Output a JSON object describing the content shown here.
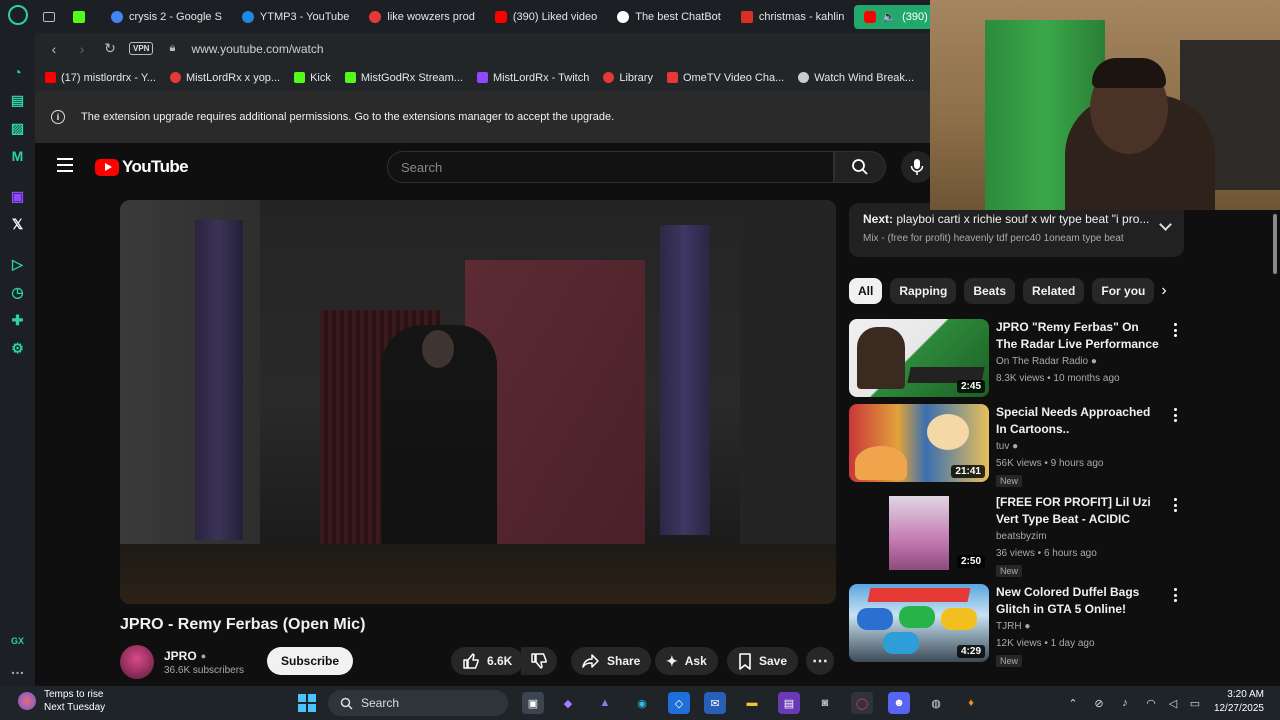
{
  "tabs": [
    {
      "label": "",
      "color": "#53fc18"
    },
    {
      "label": "crysis 2 - Google S",
      "color": "#4285f4"
    },
    {
      "label": "YTMP3 - YouTube",
      "color": "#1e88e5"
    },
    {
      "label": "like wowzers prod",
      "color": "#e53935"
    },
    {
      "label": "(390) Liked video",
      "color": "#ff0000"
    },
    {
      "label": "The best ChatBot",
      "color": "#ffffff"
    },
    {
      "label": "christmas - kahlin",
      "color": "#d93025"
    },
    {
      "label": "(390) J",
      "color": "#ff0000",
      "active": true
    }
  ],
  "address": {
    "vpn": "VPN",
    "url": "www.youtube.com/watch"
  },
  "bookmarks": [
    {
      "label": "(17) mistlordrx - Y...",
      "color": "#ff0000"
    },
    {
      "label": "MistLordRx x yop...",
      "color": "#e53935"
    },
    {
      "label": "Kick",
      "color": "#53fc18"
    },
    {
      "label": "MistGodRx Stream...",
      "color": "#53fc18"
    },
    {
      "label": "MistLordRx - Twitch",
      "color": "#9146ff"
    },
    {
      "label": "Library",
      "color": "#e53935"
    },
    {
      "label": "OmeTV Video Cha...",
      "color": "#e53935"
    },
    {
      "label": "Watch Wind Break...",
      "color": "#cccccc"
    }
  ],
  "notice": "The extension upgrade requires additional permissions. Go to the extensions manager to accept the upgrade.",
  "yt": {
    "logo": "YouTube",
    "search_placeholder": "Search"
  },
  "video": {
    "title": "JPRO - Remy Ferbas (Open Mic)",
    "channel": "JPRO",
    "subscribers": "36.6K subscribers",
    "subscribe": "Subscribe",
    "likes": "6.6K",
    "share": "Share",
    "ask": "Ask",
    "save": "Save"
  },
  "upnext": {
    "prefix": "Next:",
    "title": "playboi carti x richie souf x wlr type beat \"i pro...",
    "subtitle": "Mix - (free for profit) heavenly tdf perc40 1oneam type beat"
  },
  "chips": [
    "All",
    "Rapping",
    "Beats",
    "Related",
    "For you"
  ],
  "recommendations": [
    {
      "title": "JPRO \"Remy Ferbas\" On The Radar Live Performance",
      "channel": "On The Radar Radio",
      "verified": true,
      "meta": "8.3K views • 10 months ago",
      "duration": "2:45",
      "is_new": false
    },
    {
      "title": "Special Needs Approached In Cartoons..",
      "channel": "tuv",
      "verified": true,
      "meta": "56K views • 9 hours ago",
      "duration": "21:41",
      "is_new": true
    },
    {
      "title": "[FREE FOR PROFIT] Lil Uzi Vert Type Beat - ACIDIC",
      "channel": "beatsbyzim",
      "verified": false,
      "meta": "36 views • 6 hours ago",
      "duration": "2:50",
      "is_new": true
    },
    {
      "title": "New Colored Duffel Bags Glitch in GTA 5 Online!",
      "channel": "TJRH",
      "verified": true,
      "meta": "12K views • 1 day ago",
      "duration": "4:29",
      "is_new": true
    }
  ],
  "new_badge": "New",
  "taskbar": {
    "weather_line1": "Temps to rise",
    "weather_line2": "Next Tuesday",
    "search": "Search",
    "time": "3:20 AM",
    "date": "12/27/2025"
  }
}
